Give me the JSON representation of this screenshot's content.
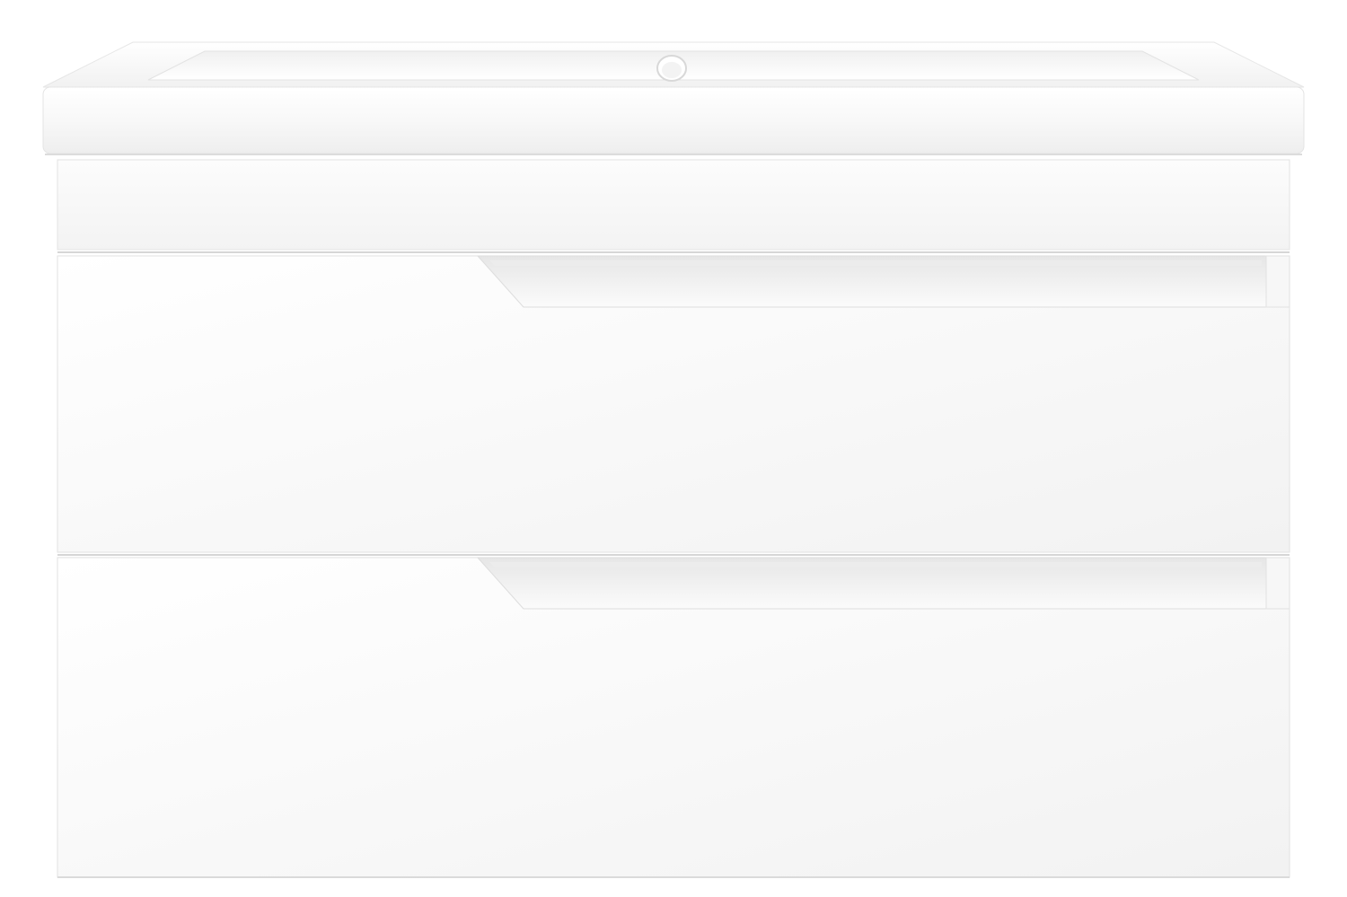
{
  "image": {
    "subject": "",
    "colors": {
      "background": "#ffffff",
      "basin": "#fafafa",
      "cabinet": "#f6f6f6",
      "shadow": "#d9d9d9",
      "edge": "#e2e2e2"
    }
  }
}
